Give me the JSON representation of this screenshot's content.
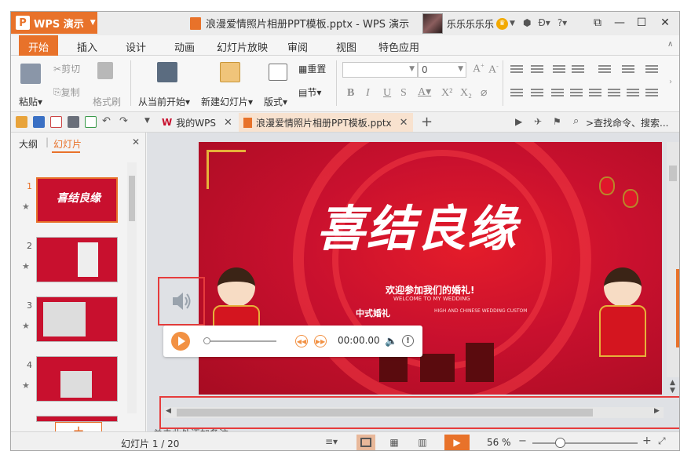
{
  "app": {
    "name": "WPS 演示",
    "doc_title": "浪漫爱情照片相册PPT模板.pptx - WPS 演示",
    "user": "乐乐乐乐乐"
  },
  "ribbon_tabs": [
    "开始",
    "插入",
    "设计",
    "动画",
    "幻灯片放映",
    "审阅",
    "视图",
    "特色应用"
  ],
  "ribbon": {
    "paste": "粘贴",
    "cut": "剪切",
    "copy": "复制",
    "format_painter": "格式刷",
    "from_current": "从当前开始",
    "new_slide": "新建幻灯片",
    "layout": "版式",
    "reset": "重置",
    "section": "节",
    "font_size": "0"
  },
  "doc_tabs": {
    "home": "我的WPS",
    "file": "浪漫爱情照片相册PPT模板.pptx"
  },
  "search_cmd": ">查找命令、搜索...",
  "panel": {
    "tab_outline": "大纲",
    "tab_slides": "幻灯片",
    "thumbs": [
      "1",
      "2",
      "3",
      "4"
    ]
  },
  "slide": {
    "title": "喜结良缘",
    "subtitle": "欢迎参加我们的婚礼!",
    "subtitle_en": "WELCOME TO MY WEDDING",
    "tag": "中式婚礼",
    "tag_en": "HIGH AND CHINESE WEDDING CUSTOM"
  },
  "player": {
    "time": "00:00.00"
  },
  "notes_hint": "单击此处添加备注",
  "status": {
    "slide_count": "幻灯片 1 / 20",
    "zoom": "56 %"
  },
  "colors": {
    "accent": "#e8722a",
    "slide_red": "#c8102e",
    "highlight": "#e63c3c"
  }
}
